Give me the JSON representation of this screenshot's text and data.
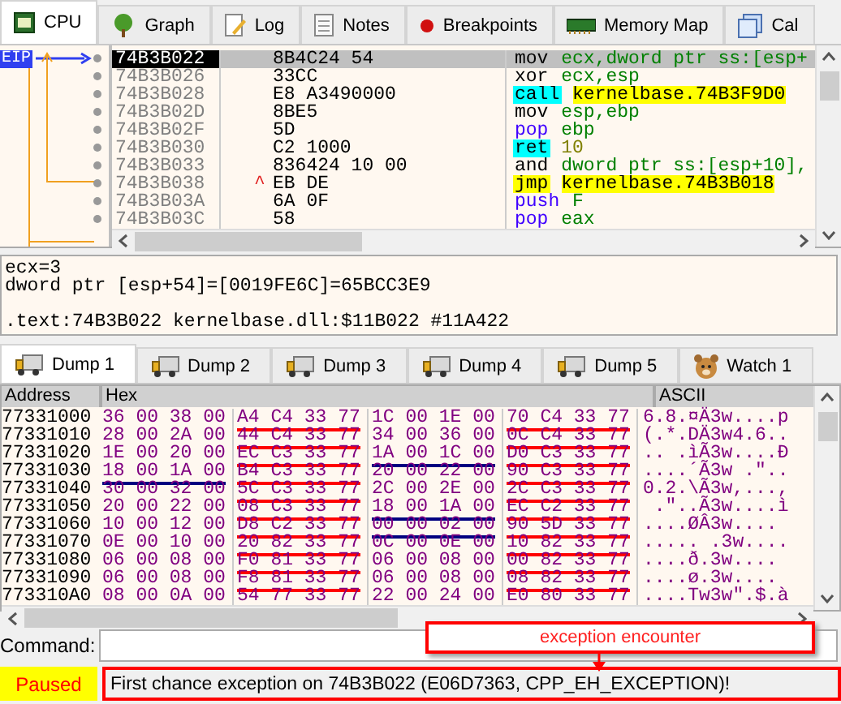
{
  "top_tabs": [
    {
      "label": "CPU",
      "selected": true
    },
    {
      "label": "Graph",
      "selected": false
    },
    {
      "label": "Log",
      "selected": false
    },
    {
      "label": "Notes",
      "selected": false
    },
    {
      "label": "Breakpoints",
      "selected": false
    },
    {
      "label": "Memory Map",
      "selected": false
    },
    {
      "label": "Cal",
      "selected": false
    }
  ],
  "disassembly": {
    "eip_label": "EIP",
    "rows": [
      {
        "address": "74B3B022",
        "bytes": "8B4C24 54",
        "jump_mark": "",
        "mnemonic": "mov",
        "operands": "ecx,dword ptr ss:[esp+",
        "kind": "mov",
        "selected": true
      },
      {
        "address": "74B3B026",
        "bytes": "33CC",
        "jump_mark": "",
        "mnemonic": "xor",
        "operands": "ecx,esp",
        "kind": "mov",
        "selected": false
      },
      {
        "address": "74B3B028",
        "bytes": "E8 A3490000",
        "jump_mark": "",
        "mnemonic": "call",
        "operands": "kernelbase.74B3F9D0",
        "kind": "call",
        "selected": false
      },
      {
        "address": "74B3B02D",
        "bytes": "8BE5",
        "jump_mark": "",
        "mnemonic": "mov",
        "operands": "esp,ebp",
        "kind": "mov",
        "selected": false
      },
      {
        "address": "74B3B02F",
        "bytes": "5D",
        "jump_mark": "",
        "mnemonic": "pop",
        "operands": "ebp",
        "kind": "stack",
        "selected": false
      },
      {
        "address": "74B3B030",
        "bytes": "C2 1000",
        "jump_mark": "",
        "mnemonic": "ret",
        "operands": "10",
        "kind": "ret",
        "selected": false
      },
      {
        "address": "74B3B033",
        "bytes": "836424 10 00",
        "jump_mark": "",
        "mnemonic": "and",
        "operands": "dword ptr ss:[esp+10],",
        "kind": "mov",
        "selected": false
      },
      {
        "address": "74B3B038",
        "bytes": "EB DE",
        "jump_mark": "^",
        "mnemonic": "jmp",
        "operands": "kernelbase.74B3B018",
        "kind": "jmp",
        "selected": false
      },
      {
        "address": "74B3B03A",
        "bytes": "6A 0F",
        "jump_mark": "",
        "mnemonic": "push",
        "operands": "F",
        "kind": "stack",
        "selected": false
      },
      {
        "address": "74B3B03C",
        "bytes": "58",
        "jump_mark": "",
        "mnemonic": "pop",
        "operands": "eax",
        "kind": "stack",
        "selected": false
      }
    ]
  },
  "info_lines": [
    "ecx=3",
    "dword ptr [esp+54]=[0019FE6C]=65BCC3E9",
    ".text:74B3B022 kernelbase.dll:$11B022 #11A422"
  ],
  "dump_tabs": [
    {
      "label": "Dump 1",
      "selected": true
    },
    {
      "label": "Dump 2",
      "selected": false
    },
    {
      "label": "Dump 3",
      "selected": false
    },
    {
      "label": "Dump 4",
      "selected": false
    },
    {
      "label": "Dump 5",
      "selected": false
    },
    {
      "label": "Watch 1",
      "selected": false
    }
  ],
  "dump": {
    "columns": [
      "Address",
      "Hex",
      "ASCII"
    ],
    "rows": [
      {
        "address": "77331000",
        "groups": [
          {
            "hex": "36 00 38 00",
            "kind": "plain"
          },
          {
            "hex": "A4 C4 33 77",
            "kind": "pointer"
          },
          {
            "hex": "1C 00 1E 00",
            "kind": "plain"
          },
          {
            "hex": "70 C4 33 77",
            "kind": "pointer"
          }
        ],
        "ascii": "6.8.¤Ä3w....p"
      },
      {
        "address": "77331010",
        "groups": [
          {
            "hex": "28 00 2A 00",
            "kind": "plain"
          },
          {
            "hex": "44 C4 33 77",
            "kind": "pointer"
          },
          {
            "hex": "34 00 36 00",
            "kind": "plain"
          },
          {
            "hex": "0C C4 33 77",
            "kind": "pointer"
          }
        ],
        "ascii": "(.*.DÄ3w4.6.."
      },
      {
        "address": "77331020",
        "groups": [
          {
            "hex": "1E 00 20 00",
            "kind": "plain"
          },
          {
            "hex": "EC C3 33 77",
            "kind": "pointer"
          },
          {
            "hex": "1A 00 1C 00",
            "kind": "marked"
          },
          {
            "hex": "D0 C3 33 77",
            "kind": "pointer"
          }
        ],
        "ascii": ".. .ìÃ3w....Ð"
      },
      {
        "address": "77331030",
        "groups": [
          {
            "hex": "18 00 1A 00",
            "kind": "marked"
          },
          {
            "hex": "B4 C3 33 77",
            "kind": "pointer"
          },
          {
            "hex": "20 00 22 00",
            "kind": "plain"
          },
          {
            "hex": "90 C3 33 77",
            "kind": "pointer"
          }
        ],
        "ascii": "....´Ã3w .\".."
      },
      {
        "address": "77331040",
        "groups": [
          {
            "hex": "30 00 32 00",
            "kind": "plain"
          },
          {
            "hex": "5C C3 33 77",
            "kind": "pointer"
          },
          {
            "hex": "2C 00 2E 00",
            "kind": "plain"
          },
          {
            "hex": "2C C3 33 77",
            "kind": "pointer"
          }
        ],
        "ascii": "0.2.\\Ã3w,...,"
      },
      {
        "address": "77331050",
        "groups": [
          {
            "hex": "20 00 22 00",
            "kind": "plain"
          },
          {
            "hex": "08 C3 33 77",
            "kind": "pointer"
          },
          {
            "hex": "18 00 1A 00",
            "kind": "marked"
          },
          {
            "hex": "EC C2 33 77",
            "kind": "pointer"
          }
        ],
        "ascii": " .\"..Ã3w....ì"
      },
      {
        "address": "77331060",
        "groups": [
          {
            "hex": "10 00 12 00",
            "kind": "plain"
          },
          {
            "hex": "D8 C2 33 77",
            "kind": "pointer"
          },
          {
            "hex": "00 00 02 00",
            "kind": "marked"
          },
          {
            "hex": "90 5D 33 77",
            "kind": "pointer"
          }
        ],
        "ascii": "....ØÂ3w...."
      },
      {
        "address": "77331070",
        "groups": [
          {
            "hex": "0E 00 10 00",
            "kind": "plain"
          },
          {
            "hex": "20 82 33 77",
            "kind": "pointer"
          },
          {
            "hex": "0C 00 0E 00",
            "kind": "plain"
          },
          {
            "hex": "10 82 33 77",
            "kind": "pointer"
          }
        ],
        "ascii": "..... .3w...."
      },
      {
        "address": "77331080",
        "groups": [
          {
            "hex": "06 00 08 00",
            "kind": "plain"
          },
          {
            "hex": "F0 81 33 77",
            "kind": "pointer"
          },
          {
            "hex": "06 00 08 00",
            "kind": "plain"
          },
          {
            "hex": "00 82 33 77",
            "kind": "pointer"
          }
        ],
        "ascii": "....ð.3w...."
      },
      {
        "address": "77331090",
        "groups": [
          {
            "hex": "06 00 08 00",
            "kind": "plain"
          },
          {
            "hex": "F8 81 33 77",
            "kind": "pointer"
          },
          {
            "hex": "06 00 08 00",
            "kind": "plain"
          },
          {
            "hex": "08 82 33 77",
            "kind": "pointer"
          }
        ],
        "ascii": "....ø.3w...."
      },
      {
        "address": "773310A0",
        "groups": [
          {
            "hex": "08 00 0A 00",
            "kind": "plain"
          },
          {
            "hex": "54 77 33 77",
            "kind": "pointer"
          },
          {
            "hex": "22 00 24 00",
            "kind": "plain"
          },
          {
            "hex": "E0 80 33 77",
            "kind": "pointer"
          }
        ],
        "ascii": "....Tw3w\".$.à"
      }
    ]
  },
  "command": {
    "label": "Command:"
  },
  "annotation": {
    "text": "exception encounter"
  },
  "status_bar": {
    "state": "Paused",
    "message": "First chance exception on 74B3B022 (E06D7363, CPP_EH_EXCEPTION)!"
  }
}
